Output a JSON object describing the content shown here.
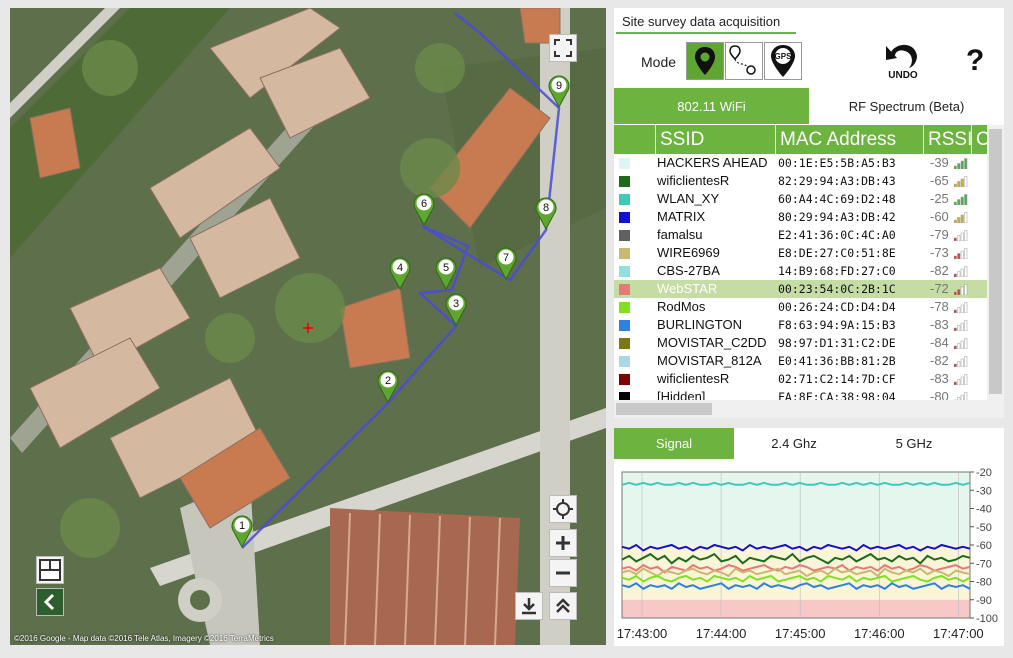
{
  "map": {
    "attribution": "©2016 Google - Map data ©2016 Tele Atlas, Imagery ©2016 TerraMetrics",
    "waypoints": [
      "1",
      "2",
      "3",
      "4",
      "5",
      "6",
      "7",
      "8",
      "9"
    ]
  },
  "survey": {
    "title": "Site survey data acquisition",
    "mode_label": "Mode",
    "mode_buttons": [
      "pin-mode-icon",
      "path-mode-icon",
      "gps-mode-icon"
    ],
    "gps_text": "GPS",
    "undo_label": "UNDO",
    "help_label": "?",
    "tabs": {
      "wifi": "802.11 WiFi",
      "rf": "RF Spectrum (Beta)"
    },
    "columns": [
      "SSID",
      "MAC Address",
      "RSSI",
      "C"
    ],
    "networks": [
      {
        "ssid": "HACKERS AHEAD",
        "mac": "00:1E:E5:5B:A5:B3",
        "rssi": "-39",
        "color": "#e0f4f8"
      },
      {
        "ssid": "wificlientesR",
        "mac": "82:29:94:A3:DB:43",
        "rssi": "-65",
        "color": "#1b6b1b"
      },
      {
        "ssid": "WLAN_XY",
        "mac": "60:A4:4C:69:D2:48",
        "rssi": "-25",
        "color": "#40c8b8"
      },
      {
        "ssid": "MATRIX",
        "mac": "80:29:94:A3:DB:42",
        "rssi": "-60",
        "color": "#1010d0"
      },
      {
        "ssid": "famalsu",
        "mac": "E2:41:36:0C:4C:A0",
        "rssi": "-79",
        "color": "#606060"
      },
      {
        "ssid": "WIRE6969",
        "mac": "E8:DE:27:C0:51:8E",
        "rssi": "-73",
        "color": "#c8b870"
      },
      {
        "ssid": "CBS-27BA",
        "mac": "14:B9:68:FD:27:C0",
        "rssi": "-82",
        "color": "#90e0e0"
      },
      {
        "ssid": "WebSTAR",
        "mac": "00:23:54:0C:2B:1C",
        "rssi": "-72",
        "color": "#e87878"
      },
      {
        "ssid": "RodMos",
        "mac": "00:26:24:CD:D4:D4",
        "rssi": "-78",
        "color": "#80e020"
      },
      {
        "ssid": "BURLINGTON",
        "mac": "F8:63:94:9A:15:B3",
        "rssi": "-83",
        "color": "#3080e0"
      },
      {
        "ssid": "MOVISTAR_C2DD",
        "mac": "98:97:D1:31:C2:DE",
        "rssi": "-84",
        "color": "#7a7a10"
      },
      {
        "ssid": "MOVISTAR_812A",
        "mac": "E0:41:36:BB:81:2B",
        "rssi": "-82",
        "color": "#a8d8e8"
      },
      {
        "ssid": "wificlientesR",
        "mac": "02:71:C2:14:7D:CF",
        "rssi": "-83",
        "color": "#800000"
      },
      {
        "ssid": "[Hidden]",
        "mac": "FA:8F:CA:38:98:04",
        "rssi": "-80",
        "color": "#000000"
      }
    ],
    "selected_index": 7
  },
  "signal": {
    "tabs": {
      "signal": "Signal",
      "g24": "2.4 Ghz",
      "g5": "5 GHz"
    },
    "chart_data": {
      "type": "line",
      "ylim": [
        -100,
        -20
      ],
      "yticks": [
        "-20",
        "-30",
        "-40",
        "-50",
        "-60",
        "-70",
        "-80",
        "-90",
        "-100"
      ],
      "xticks": [
        "17:43:00",
        "17:44:00",
        "17:45:00",
        "17:46:00",
        "17:47:00"
      ],
      "bands": [
        {
          "from": -20,
          "to": -60,
          "color": "#e4f6ee"
        },
        {
          "from": -60,
          "to": -90,
          "color": "#fbf5d8"
        },
        {
          "from": -90,
          "to": -100,
          "color": "#f7c8c8"
        }
      ],
      "series": [
        {
          "color": "#40c8b8",
          "values": [
            -27,
            -26,
            -27,
            -26,
            -27,
            -26,
            -27,
            -27,
            -26,
            -27,
            -26,
            -27,
            -27,
            -26,
            -27,
            -26,
            -27,
            -27,
            -26,
            -27,
            -26,
            -27,
            -27,
            -26,
            -27,
            -26,
            -27,
            -27,
            -26,
            -27,
            -27,
            -26,
            -27,
            -26,
            -27,
            -26,
            -27,
            -26,
            -27,
            -27,
            -26,
            -27,
            -26,
            -27,
            -26,
            -27,
            -27,
            -26,
            -27,
            -26
          ]
        },
        {
          "color": "#1010d0",
          "values": [
            -61,
            -62,
            -60,
            -63,
            -61,
            -62,
            -61,
            -60,
            -62,
            -61,
            -63,
            -61,
            -62,
            -60,
            -61,
            -62,
            -61,
            -63,
            -60,
            -62,
            -61,
            -62,
            -61,
            -60,
            -62,
            -61,
            -63,
            -61,
            -62,
            -60,
            -61,
            -62,
            -61,
            -63,
            -60,
            -62,
            -61,
            -62,
            -61,
            -60,
            -62,
            -61,
            -63,
            -61,
            -62,
            -60,
            -61,
            -62,
            -61,
            -62
          ]
        },
        {
          "color": "#1b6b1b",
          "values": [
            -68,
            -66,
            -69,
            -67,
            -65,
            -68,
            -66,
            -70,
            -67,
            -69,
            -66,
            -68,
            -67,
            -65,
            -69,
            -68,
            -66,
            -70,
            -67,
            -68,
            -69,
            -66,
            -67,
            -68,
            -65,
            -69,
            -67,
            -66,
            -68,
            -70,
            -67,
            -68,
            -66,
            -69,
            -67,
            -65,
            -68,
            -67,
            -69,
            -66,
            -68,
            -67,
            -70,
            -66,
            -68,
            -67,
            -69,
            -68,
            -66,
            -67
          ]
        },
        {
          "color": "#e87878",
          "values": [
            -73,
            -72,
            -74,
            -71,
            -73,
            -72,
            -75,
            -72,
            -73,
            -74,
            -71,
            -73,
            -72,
            -74,
            -73,
            -71,
            -72,
            -74,
            -73,
            -72,
            -71,
            -73,
            -74,
            -72,
            -73,
            -71,
            -72,
            -74,
            -73,
            -72,
            -73,
            -71,
            -74,
            -72,
            -73,
            -72,
            -74,
            -71,
            -73,
            -72,
            -74,
            -73,
            -71,
            -72,
            -74,
            -73,
            -72,
            -71,
            -73,
            -72
          ]
        },
        {
          "color": "#c8b870",
          "values": [
            -75,
            -74,
            -76,
            -73,
            -75,
            -77,
            -74,
            -75,
            -76,
            -74,
            -73,
            -75,
            -76,
            -74,
            -75,
            -77,
            -73,
            -75,
            -74,
            -76,
            -75,
            -74,
            -73,
            -76,
            -75,
            -74,
            -77,
            -75,
            -74,
            -76,
            -73,
            -75,
            -74,
            -76,
            -75,
            -74,
            -77,
            -73,
            -75,
            -76,
            -74,
            -75,
            -73,
            -76,
            -74,
            -75,
            -77,
            -74,
            -75,
            -76
          ]
        },
        {
          "color": "#80e020",
          "values": [
            -78,
            -79,
            -77,
            -80,
            -78,
            -77,
            -79,
            -80,
            -78,
            -77,
            -79,
            -78,
            -80,
            -77,
            -78,
            -79,
            -78,
            -80,
            -77,
            -79,
            -78,
            -77,
            -80,
            -79,
            -78,
            -77,
            -79,
            -78,
            -80,
            -77,
            -78,
            -79,
            -77,
            -80,
            -78,
            -79,
            -78,
            -77,
            -80,
            -79,
            -78,
            -77,
            -79,
            -80,
            -78,
            -77,
            -79,
            -78,
            -80,
            -78
          ]
        },
        {
          "color": "#3080e0",
          "values": [
            -82,
            -83,
            -81,
            -84,
            -82,
            -83,
            -82,
            -84,
            -81,
            -83,
            -82,
            -84,
            -83,
            -82,
            -81,
            -84,
            -82,
            -83,
            -82,
            -84,
            -81,
            -83,
            -82,
            -83,
            -84,
            -82,
            -81,
            -83,
            -82,
            -84,
            -83,
            -82,
            -81,
            -84,
            -82,
            -83,
            -82,
            -84,
            -81,
            -83,
            -82,
            -84,
            -83,
            -82,
            -81,
            -84,
            -82,
            -83,
            -82,
            -84
          ]
        }
      ]
    }
  }
}
